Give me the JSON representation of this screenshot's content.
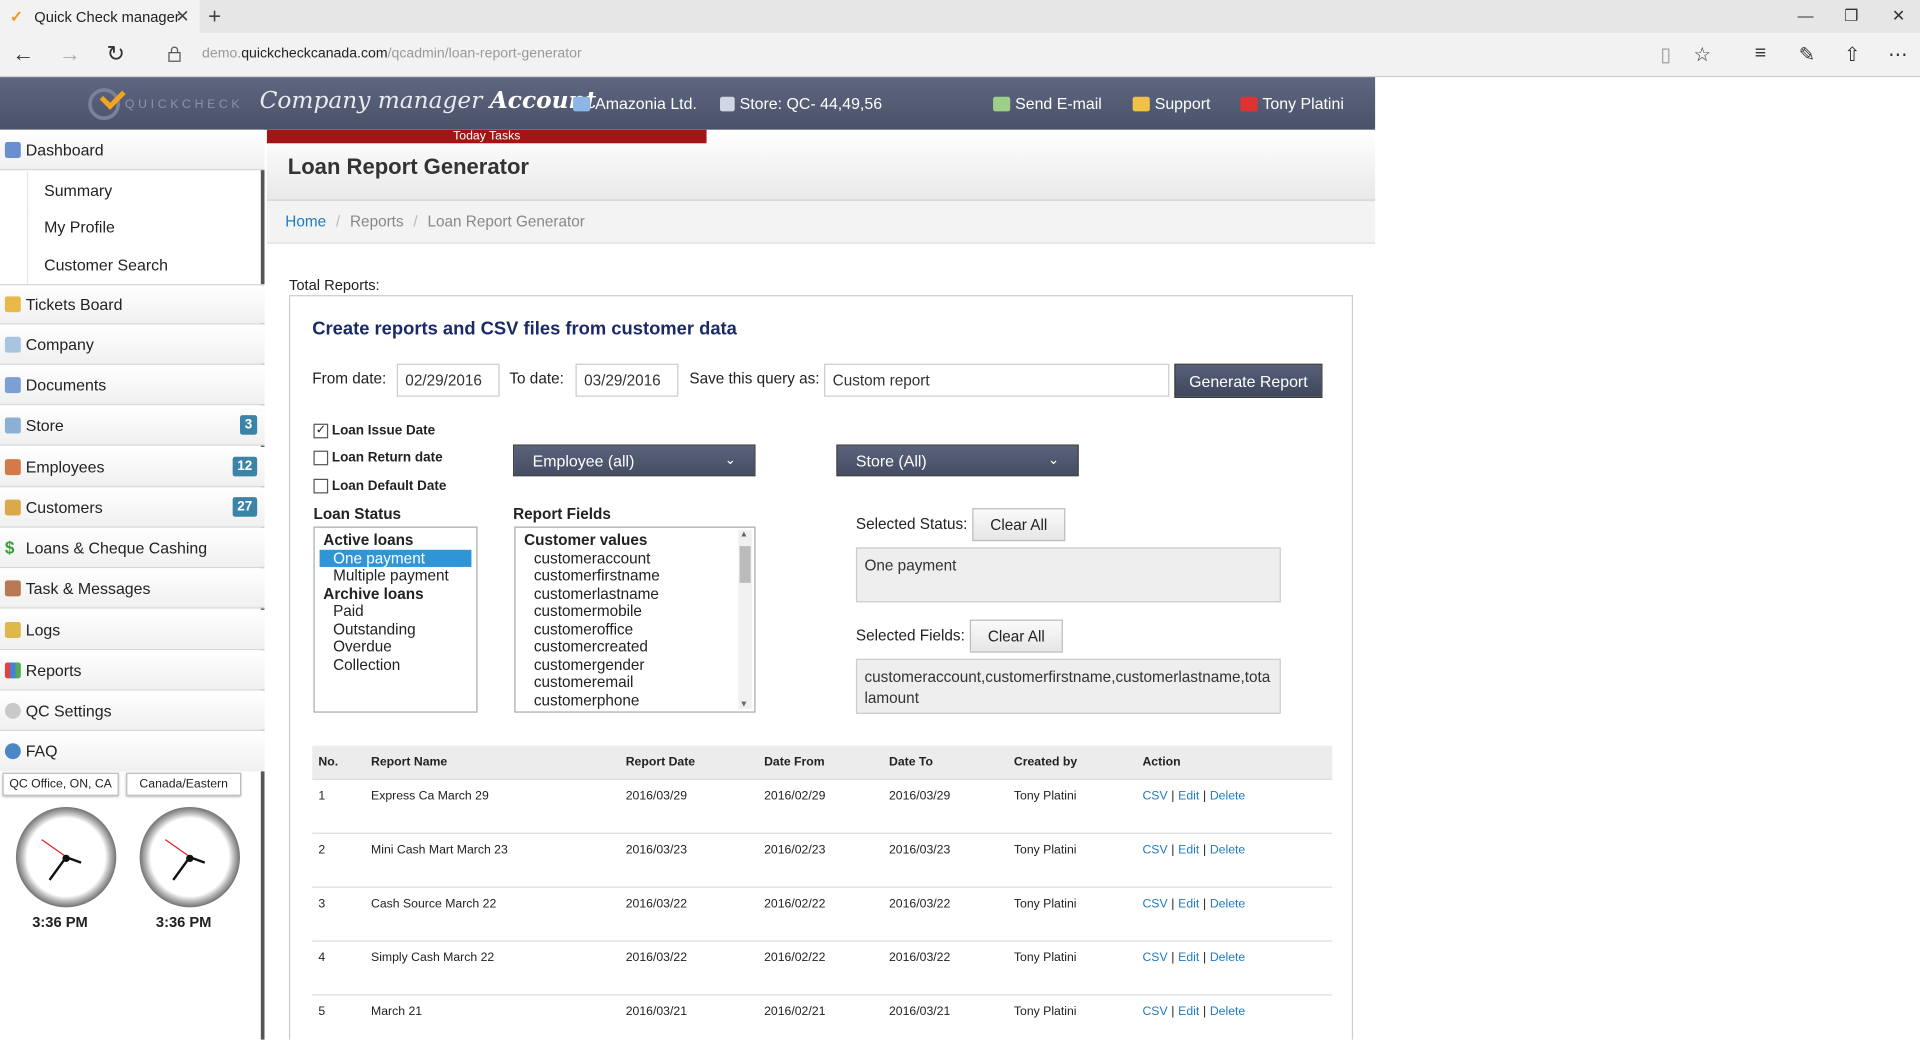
{
  "browser": {
    "tab_title": "Quick Check manager",
    "url_host": "demo.",
    "url_domain": "quickcheckcanada.com",
    "url_path": "/qcadmin/loan-report-generator"
  },
  "header": {
    "logo_text": "QUICKCHECK",
    "title_italic": "Company manager",
    "title_bold": "Account",
    "company": "Amazonia Ltd.",
    "store": "Store: QC- 44,49,56",
    "send_email": "Send E-mail",
    "support": "Support",
    "user": "Tony Platini"
  },
  "sidebar": {
    "dashboard": "Dashboard",
    "summary": "Summary",
    "my_profile": "My Profile",
    "customer_search": "Customer Search",
    "tickets": "Tickets Board",
    "company": "Company",
    "documents": "Documents",
    "store": "Store",
    "store_count": "3",
    "employees": "Employees",
    "employees_count": "12",
    "customers": "Customers",
    "customers_count": "27",
    "loans": "Loans & Cheque Cashing",
    "tasks": "Task & Messages",
    "logs": "Logs",
    "reports": "Reports",
    "qc_settings": "QC Settings",
    "faq": "FAQ",
    "tz1": "QC Office, ON, CA",
    "tz2": "Canada/Eastern",
    "time1": "3:36 PM",
    "time2": "3:36 PM"
  },
  "page": {
    "today_tasks": "Today Tasks",
    "title": "Loan Report Generator",
    "breadcrumb": {
      "home": "Home",
      "reports": "Reports",
      "current": "Loan Report Generator"
    },
    "total_reports": "Total Reports:"
  },
  "form": {
    "heading": "Create reports and CSV files from customer data",
    "from_label": "From date:",
    "from_value": "02/29/2016",
    "to_label": "To date:",
    "to_value": "03/29/2016",
    "save_label": "Save this query as:",
    "save_value": "Custom report",
    "generate": "Generate Report",
    "chk_issue": "Loan Issue Date",
    "chk_return": "Loan Return date",
    "chk_default": "Loan Default Date",
    "employee_dd": "Employee (all)",
    "store_dd": "Store (All)",
    "loan_status_label": "Loan Status",
    "report_fields_label": "Report Fields",
    "status_list": {
      "g1": "Active loans",
      "o1": "One payment",
      "o2": "Multiple payment",
      "g2": "Archive loans",
      "o3": "Paid",
      "o4": "Outstanding",
      "o5": "Overdue",
      "o6": "Collection"
    },
    "fields_list": {
      "g1": "Customer values",
      "f1": "customeraccount",
      "f2": "customerfirstname",
      "f3": "customerlastname",
      "f4": "customermobile",
      "f5": "customeroffice",
      "f6": "customercreated",
      "f7": "customergender",
      "f8": "customeremail",
      "f9": "customerphone"
    },
    "selected_status_label": "Selected Status:",
    "clear_all": "Clear All",
    "selected_status_value": "One payment",
    "selected_fields_label": "Selected Fields:",
    "selected_fields_value": "customeraccount,customerfirstname,customerlastname,totalamount"
  },
  "table": {
    "headers": {
      "no": "No.",
      "name": "Report Name",
      "date": "Report Date",
      "from": "Date From",
      "to": "Date To",
      "by": "Created by",
      "action": "Action"
    },
    "actions": {
      "csv": "CSV",
      "edit": "Edit",
      "del": "Delete",
      "sep": "|"
    },
    "rows": [
      {
        "no": "1",
        "name": "Express Ca March 29",
        "date": "2016/03/29",
        "from": "2016/02/29",
        "to": "2016/03/29",
        "by": "Tony Platini"
      },
      {
        "no": "2",
        "name": "Mini Cash Mart March 23",
        "date": "2016/03/23",
        "from": "2016/02/23",
        "to": "2016/03/23",
        "by": "Tony Platini"
      },
      {
        "no": "3",
        "name": "Cash Source March 22",
        "date": "2016/03/22",
        "from": "2016/02/22",
        "to": "2016/03/22",
        "by": "Tony Platini"
      },
      {
        "no": "4",
        "name": "Simply Cash March 22",
        "date": "2016/03/22",
        "from": "2016/02/22",
        "to": "2016/03/22",
        "by": "Tony Platini"
      },
      {
        "no": "5",
        "name": "March 21",
        "date": "2016/03/21",
        "from": "2016/02/21",
        "to": "2016/03/21",
        "by": "Tony Platini"
      }
    ]
  }
}
